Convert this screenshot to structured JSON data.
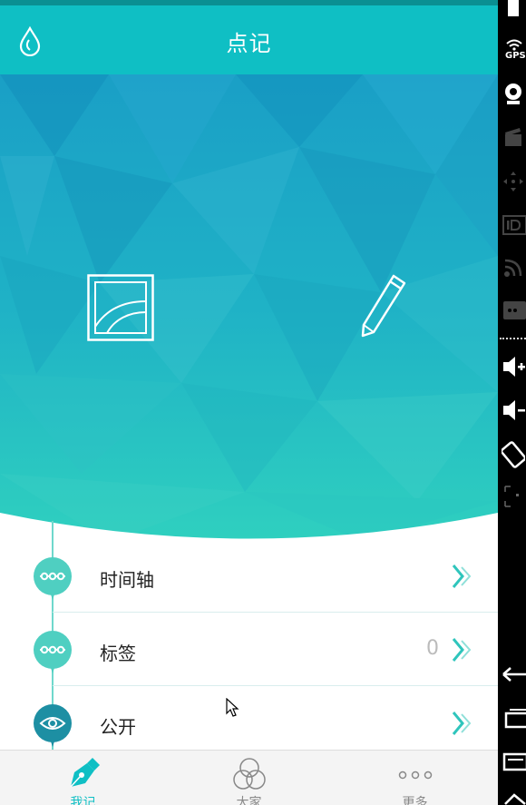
{
  "header": {
    "title": "点记"
  },
  "list": {
    "rows": [
      {
        "label": "时间轴",
        "count": ""
      },
      {
        "label": "标签",
        "count": "0"
      },
      {
        "label": "公开",
        "count": ""
      }
    ]
  },
  "tabs": [
    {
      "label": "我记",
      "active": true
    },
    {
      "label": "大家",
      "active": false
    },
    {
      "label": "更多",
      "active": false
    }
  ],
  "system_bar": {
    "gps": "GPS"
  },
  "colors": {
    "brand": "#0fbfc4",
    "node": "#4fcfc1",
    "node_dark": "#1d8fa3",
    "chevron": "#2fc5bc"
  }
}
